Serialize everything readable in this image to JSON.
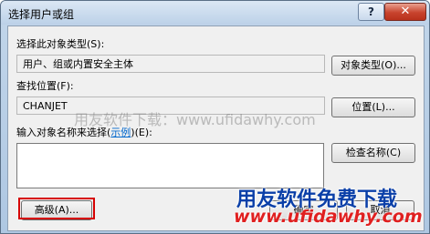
{
  "window": {
    "title": "选择用户或组"
  },
  "titlebar": {
    "help_label": "?",
    "close_label": "✕"
  },
  "object_type": {
    "label": "选择此对象类型(S):",
    "value": "用户、组或内置安全主体",
    "button_label": "对象类型(O)..."
  },
  "location": {
    "label": "查找位置(F):",
    "value": "CHANJET",
    "button_label": "位置(L)..."
  },
  "names": {
    "label_prefix": "输入对象名称来选择(",
    "example_link": "示例",
    "label_suffix": ")(E):",
    "value": "",
    "check_button_label": "检查名称(C)"
  },
  "footer": {
    "advanced_label": "高级(A)...",
    "ok_label": "确定",
    "cancel_label": "取消"
  },
  "watermarks": {
    "center_text": "用友软件下载：www.ufidawhy.com",
    "logo_text": "用友软件免费下载",
    "url_text": "www.ufidawhy.com"
  },
  "colors": {
    "highlight_border": "#d60000",
    "logo_blue": "#0a3fa8",
    "url_red": "#e02020"
  }
}
